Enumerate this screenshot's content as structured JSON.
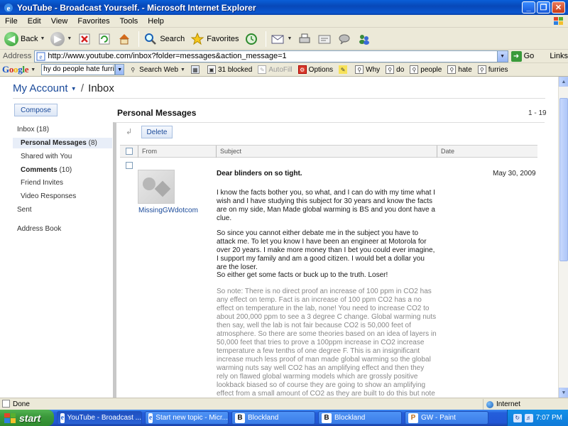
{
  "window": {
    "title": "YouTube - Broadcast Yourself. - Microsoft Internet Explorer",
    "controls": [
      "_",
      "❐",
      "✕"
    ]
  },
  "menu": [
    "File",
    "Edit",
    "View",
    "Favorites",
    "Tools",
    "Help"
  ],
  "toolbar": {
    "back": "Back",
    "search": "Search",
    "favorites": "Favorites"
  },
  "address": {
    "label": "Address",
    "url": "http://www.youtube.com/inbox?folder=messages&action_message=1",
    "go": "Go",
    "links": "Links"
  },
  "google_toolbar": {
    "logo": [
      "G",
      "o",
      "o",
      "g",
      "l",
      "e"
    ],
    "query": "hy do people hate furries",
    "search_web": "Search Web",
    "blocked": "31 blocked",
    "autofill": "AutoFill",
    "options": "Options",
    "terms": [
      "Why",
      "do",
      "people",
      "hate",
      "furries"
    ]
  },
  "page": {
    "account": "My Account",
    "separator": "/",
    "inbox": "Inbox",
    "compose": "Compose",
    "title": "Personal Messages",
    "pager": "1 - 19"
  },
  "sidebar": {
    "inbox": {
      "label": "Inbox",
      "count": "(18)"
    },
    "personal": {
      "label": "Personal Messages",
      "count": "(8)"
    },
    "shared": {
      "label": "Shared with You"
    },
    "comments": {
      "label": "Comments",
      "count": "(10)"
    },
    "invites": {
      "label": "Friend Invites"
    },
    "responses": {
      "label": "Video Responses"
    },
    "sent": {
      "label": "Sent"
    },
    "addressbook": {
      "label": "Address Book"
    }
  },
  "messages": {
    "delete": "Delete",
    "columns": {
      "from": "From",
      "subject": "Subject",
      "date": "Date"
    },
    "item": {
      "sender": "MissingGWdotcom",
      "subject": "Dear blinders on so tight.",
      "date": "May 30, 2009",
      "body": [
        "I know the facts bother you, so what, and I can do with my time what I wish and I have studying this subject for 30 years and know the facts are on my side, Man Made global warming is BS and you dont have a clue.",
        "So since you cannot either debate me in the subject you have to attack me. To let you know I have been an engineer at Motorola for over 20 years. I make more money than I bet you could ever imagine, I support my family and am a good citizen. I would bet a dollar you are the loser.",
        "So either get some facts or buck up to the truth. Loser!"
      ],
      "quoted": "So note: There is no direct proof an increase of 100 ppm in CO2 has any effect on temp. Fact is an increase of 100 ppm CO2 has a no effect on temperature in the lab, none! You need to increase CO2 to about 200,000 ppm to see a 3 degree C change. Global warming nuts then say, well the lab is not fair because CO2 is 50,000 feet of atmosphere. So there are some theories based on an idea of layers in 50,000 feet that tries to prove a 100ppm increase in CO2 increase temperature a few tenths of one degree F. This is an insignificant increase much less proof of man made global warming so the global warming nuts say well CO2 has an amplifying effect and then they rely on flawed global warming models which are grossly positive lookback biased so of course they are going to show an amplifying effect from a small amount of CO2 as they are built to do this but note flawed models are not proof much less science."
    }
  },
  "status": {
    "text": "Done",
    "zone": "Internet"
  },
  "taskbar": {
    "start": "start",
    "tasks": [
      {
        "label": "YouTube - Broadcast ...",
        "icon": "e"
      },
      {
        "label": "Start new topic - Micr...",
        "icon": "e"
      },
      {
        "label": "Blockland",
        "icon": "B"
      },
      {
        "label": "Blockland",
        "icon": "B"
      },
      {
        "label": "GW - Paint",
        "icon": "P"
      }
    ],
    "clock": "7:07 PM"
  },
  "colors": {
    "titlebar": "#0a56d0",
    "link": "#1a4a9a",
    "taskbar": "#245edb",
    "start": "#3c9a3c"
  }
}
